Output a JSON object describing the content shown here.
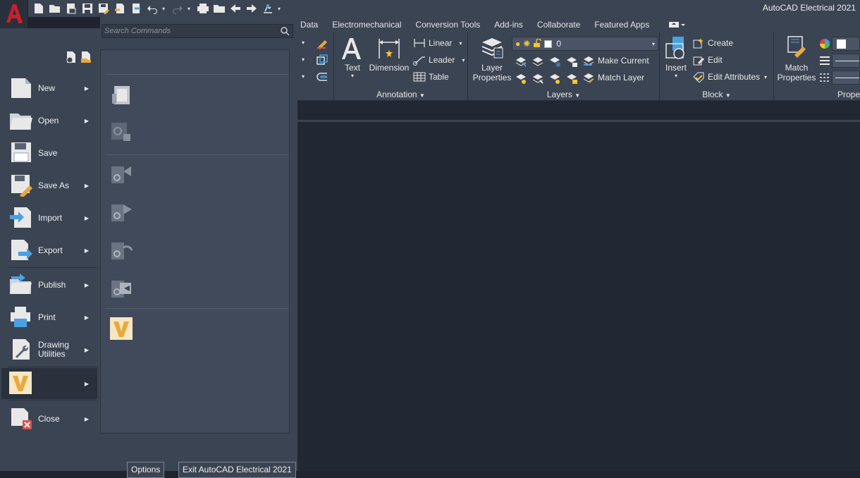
{
  "app": {
    "title": "AutoCAD Electrical 2021",
    "logo_letter": "A",
    "accent": "#c8202a"
  },
  "quick_access": [
    {
      "name": "new-icon"
    },
    {
      "name": "open-icon"
    },
    {
      "name": "sheet-set-icon"
    },
    {
      "name": "save-icon"
    },
    {
      "name": "save-as-icon"
    },
    {
      "name": "import-icon"
    },
    {
      "name": "export-icon"
    },
    {
      "name": "undo-icon"
    },
    {
      "name": "redo-icon"
    },
    {
      "name": "plot-icon"
    },
    {
      "name": "folder-icon"
    },
    {
      "name": "back-icon"
    },
    {
      "name": "forward-icon"
    },
    {
      "name": "workspace-icon"
    },
    {
      "name": "customize-icon"
    }
  ],
  "tabs": [
    "Data",
    "Electromechanical",
    "Conversion Tools",
    "Add-ins",
    "Collaborate",
    "Featured Apps"
  ],
  "ribbon": {
    "annotation": {
      "title": "Annotation",
      "text_label": "Text",
      "dimension_label": "Dimension",
      "linear_label": "Linear",
      "leader_label": "Leader",
      "table_label": "Table"
    },
    "layers": {
      "title": "Layers",
      "layer_properties_label": "Layer\nProperties",
      "current_layer": "0",
      "make_current_label": "Make Current",
      "match_layer_label": "Match Layer"
    },
    "block": {
      "title": "Block",
      "insert_label": "Insert",
      "create_label": "Create",
      "edit_label": "Edit",
      "edit_attributes_label": "Edit Attributes"
    },
    "properties": {
      "title": "Prope",
      "match_properties_label": "Match\nProperties"
    }
  },
  "app_menu": {
    "search_placeholder": "Search Commands",
    "items": [
      {
        "name": "new",
        "label": "New",
        "has_arrow": true
      },
      {
        "name": "open",
        "label": "Open",
        "has_arrow": true
      },
      {
        "name": "save",
        "label": "Save",
        "has_arrow": false
      },
      {
        "name": "save-as",
        "label": "Save As",
        "has_arrow": true
      },
      {
        "name": "import",
        "label": "Import",
        "has_arrow": true
      },
      {
        "name": "export",
        "label": "Export",
        "has_arrow": true
      },
      {
        "name": "publish",
        "label": "Publish",
        "has_arrow": true
      },
      {
        "name": "print",
        "label": "Print",
        "has_arrow": true
      },
      {
        "name": "drawing-utilities",
        "label": "Drawing\nUtilities",
        "has_arrow": true
      },
      {
        "name": "vault",
        "label": "",
        "has_arrow": true
      },
      {
        "name": "close",
        "label": "Close",
        "has_arrow": true
      }
    ],
    "options_label": "Options",
    "exit_label": "Exit AutoCAD Electrical 2021"
  }
}
